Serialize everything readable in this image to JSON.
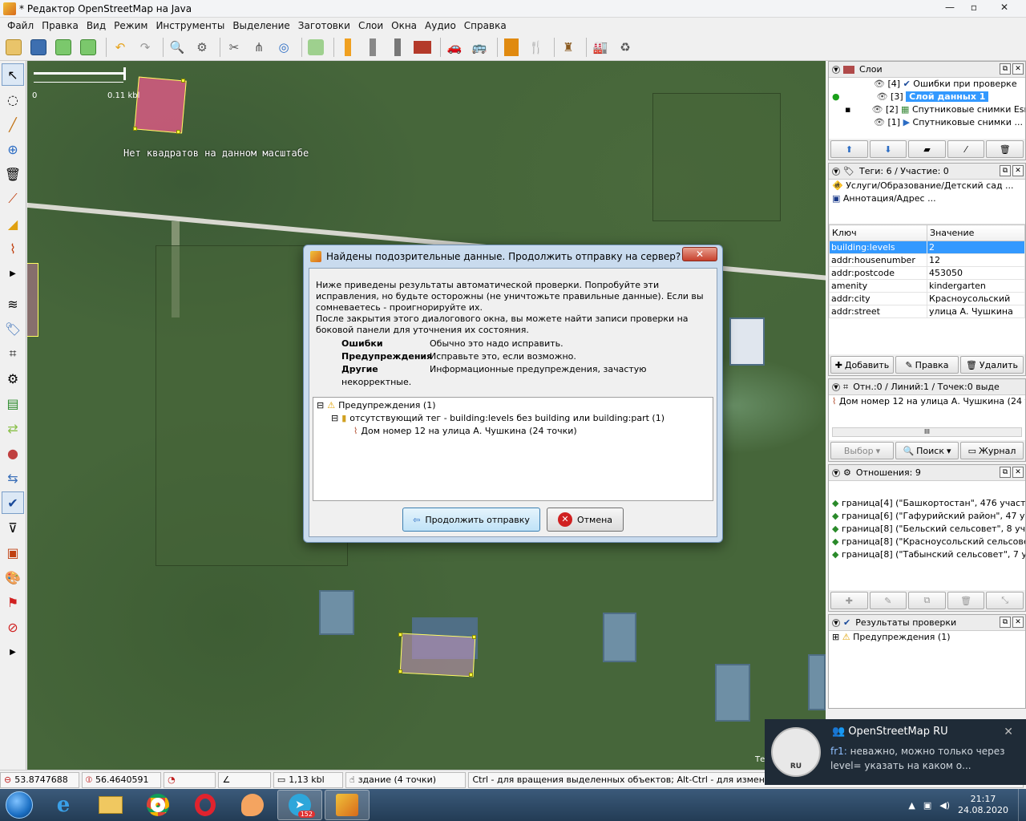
{
  "window": {
    "title": "* Редактор OpenStreetMap на Java",
    "min": "—",
    "max": "▫",
    "close": "✕"
  },
  "menu": [
    "Файл",
    "Правка",
    "Вид",
    "Режим",
    "Инструменты",
    "Выделение",
    "Заготовки",
    "Слои",
    "Окна",
    "Аудио",
    "Справка"
  ],
  "map": {
    "scale_start": "0",
    "scale_end": "0.11 kbl",
    "no_squares": "Нет квадратов на данном масштабе",
    "attribution": "Те"
  },
  "layers_panel": {
    "title": "Слои",
    "items": [
      {
        "num": "[4]",
        "name": "Ошибки при проверке"
      },
      {
        "num": "[3]",
        "name": "Слой данных 1"
      },
      {
        "num": "[2]",
        "name": "Спутниковые снимки Esri"
      },
      {
        "num": "[1]",
        "name": "Спутниковые снимки ..."
      }
    ],
    "selected_index": 1
  },
  "tags_panel": {
    "title": "Теги: 6 / Участие: 0",
    "presets": [
      "Услуги/Образование/Детский сад ...",
      "Аннотация/Адрес ..."
    ],
    "col_key": "Ключ",
    "col_value": "Значение",
    "rows": [
      {
        "key": "building:levels",
        "value": "2"
      },
      {
        "key": "addr:housenumber",
        "value": "12"
      },
      {
        "key": "addr:postcode",
        "value": "453050"
      },
      {
        "key": "amenity",
        "value": "kindergarten"
      },
      {
        "key": "addr:city",
        "value": "Красноусольский"
      },
      {
        "key": "addr:street",
        "value": "улица А. Чушкина"
      }
    ],
    "btn_add": "Добавить",
    "btn_edit": "Правка",
    "btn_delete": "Удалить"
  },
  "selection_panel": {
    "title": "Отн.:0 / Линий:1 / Точек:0 выде",
    "item": "Дом номер 12 на улица А. Чушкина (24 точ",
    "scroll_mid": "III",
    "btn_select": "Выбор",
    "btn_search": "Поиск",
    "btn_history": "Журнал"
  },
  "relations_panel": {
    "title": "Отношения: 9",
    "items": [
      "граница[4] (\"Башкортостан\", 476 участ",
      "граница[6] (\"Гафурийский район\", 47 уч",
      "граница[8] (\"Бельский сельсовет\", 8 уч",
      "граница[8] (\"Красноусольский сельсове",
      "граница[8] (\"Табынский сельсовет\", 7 у"
    ]
  },
  "validation_panel": {
    "title": "Результаты проверки",
    "item": "Предупреждения (1)"
  },
  "status": {
    "lat": "53.8747688",
    "lon": "56.4640591",
    "dist": "1,13 kbl",
    "obj": "здание (4 точки)",
    "help": "Ctrl - для вращения выделенных объектов; Alt-Ctrl - для изменения ма"
  },
  "modal": {
    "title": "Найдены подозрительные данные. Продолжить отправку на сервер?",
    "close": "✕",
    "text1": "Ниже приведены результаты автоматической проверки. Попробуйте эти исправления, но будьте осторожны (не уничтожьте правильные данные). Если вы сомневаетесь - проигнорируйте их.",
    "text2": "После закрытия этого диалогового окна, вы можете найти записи проверки на боковой панели для уточнения их состояния.",
    "legend": [
      {
        "k": "Ошибки",
        "v": "Обычно это надо исправить."
      },
      {
        "k": "Предупреждения",
        "v": "Исправьте это, если возможно."
      },
      {
        "k": "Другие",
        "v": "Информационные предупреждения, зачастую некорректные."
      }
    ],
    "tree": {
      "root": "Предупреждения (1)",
      "child": "отсутствующий тег - building:levels без building или building:part (1)",
      "leaf": "Дом номер 12 на улица А. Чушкина (24 точки)"
    },
    "btn_continue": "Продолжить отправку",
    "btn_cancel": "Отмена"
  },
  "notification": {
    "app": "OpenStreetMap RU",
    "sender": "fr1:",
    "message": " неважно, можно только через level= указать на каком о...",
    "logo_text": "RU"
  },
  "taskbar": {
    "telegram_badge": "152",
    "time": "21:17",
    "date": "24.08.2020"
  },
  "colors": {
    "selection": "#3399ff",
    "map_green": "#46663a",
    "taskbar": "#2b4a68"
  }
}
